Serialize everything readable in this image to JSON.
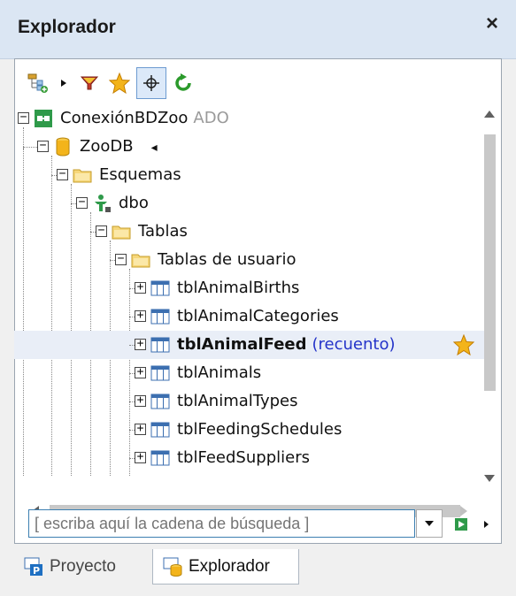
{
  "window": {
    "title": "Explorador",
    "close_label": "×"
  },
  "toolbar": {
    "buttons": [
      {
        "name": "add-connection-icon"
      },
      {
        "name": "dropdown-arrow-icon"
      },
      {
        "name": "filter-icon"
      },
      {
        "name": "favorites-star-icon"
      },
      {
        "name": "locate-crosshair-icon"
      },
      {
        "name": "refresh-icon"
      }
    ]
  },
  "tree": {
    "items": [
      {
        "label": "ConexiónBDZoo",
        "suffix": "ADO",
        "icon": "connection-icon",
        "expander": "−"
      },
      {
        "label": "ZooDB",
        "suffix": "◂",
        "icon": "database-icon",
        "expander": "−"
      },
      {
        "label": "Esquemas",
        "icon": "folder-icon",
        "expander": "−"
      },
      {
        "label": "dbo",
        "icon": "schema-user-icon",
        "expander": "−"
      },
      {
        "label": "Tablas",
        "icon": "folder-icon",
        "expander": "−"
      },
      {
        "label": "Tablas de usuario",
        "icon": "folder-icon",
        "expander": "−"
      },
      {
        "label": "tblAnimalBirths",
        "icon": "table-icon",
        "expander": "+"
      },
      {
        "label": "tblAnimalCategories",
        "icon": "table-icon",
        "expander": "+"
      },
      {
        "label": "tblAnimalFeed",
        "count": "(recuento)",
        "icon": "table-icon",
        "expander": "+",
        "favorite": true
      },
      {
        "label": "tblAnimals",
        "icon": "table-icon",
        "expander": "+"
      },
      {
        "label": "tblAnimalTypes",
        "icon": "table-icon",
        "expander": "+"
      },
      {
        "label": "tblFeedingSchedules",
        "icon": "table-icon",
        "expander": "+"
      },
      {
        "label": "tblFeedSuppliers",
        "icon": "table-icon",
        "expander": "+"
      }
    ]
  },
  "search": {
    "placeholder": "[ escriba aquí la cadena de búsqueda ]"
  },
  "tabs": [
    {
      "label": "Proyecto",
      "active": false
    },
    {
      "label": "Explorador",
      "active": true
    }
  ],
  "colors": {
    "accent": "#3c7fb1",
    "favorite_star": "#f3b41b",
    "count_text": "#2433c9",
    "title_bar": "#dbe6f3"
  }
}
